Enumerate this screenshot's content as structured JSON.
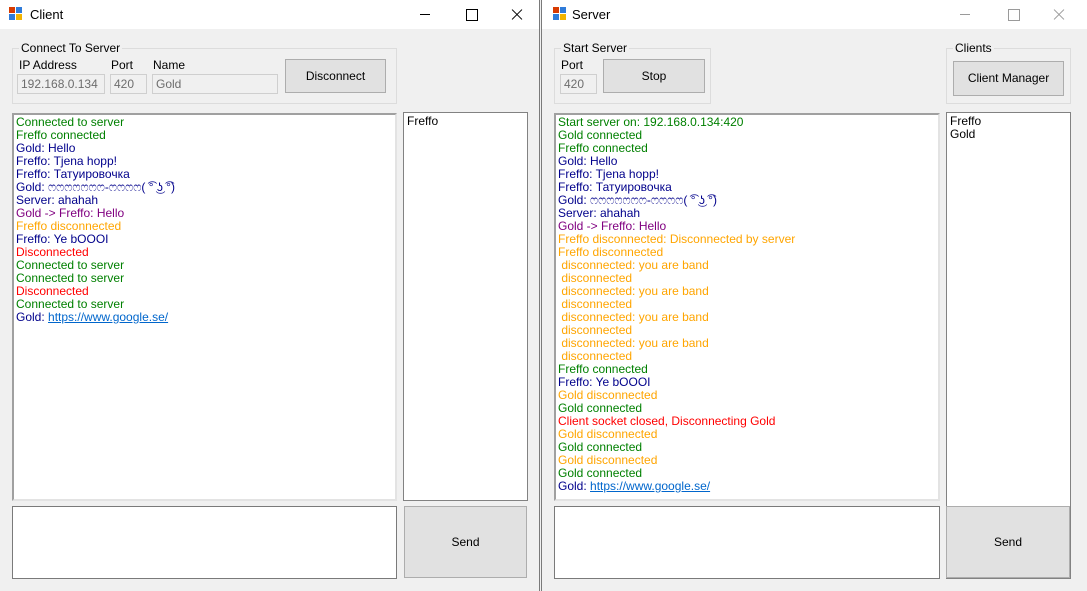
{
  "colors": {
    "green": "#008000",
    "blue": "#00008b",
    "purple": "#800080",
    "orange": "#ffa500",
    "red": "#ff0000",
    "default": "#000000"
  },
  "client": {
    "title": "Client",
    "group_label": "Connect To Server",
    "ip_label": "IP Address",
    "ip_value": "192.168.0.134",
    "port_label": "Port",
    "port_value": "420",
    "name_label": "Name",
    "name_value": "Gold",
    "disconnect_label": "Disconnect",
    "send_label": "Send",
    "users": [
      "Freffo"
    ],
    "messages": [
      {
        "text": "Connected to server",
        "color": "green"
      },
      {
        "text": "Freffo connected",
        "color": "green"
      },
      {
        "text": "Gold: Hello",
        "color": "blue"
      },
      {
        "text": "Freffo: Tjena hopp!",
        "color": "blue"
      },
      {
        "text": "Freffo: Татуировочка",
        "color": "blue"
      },
      {
        "text": "Gold: ෆෆෆෆෆෆෆ-ෆෆෆෆ( ͡° ͜ʖ ͡°)",
        "color": "blue"
      },
      {
        "text": "Server: ahahah",
        "color": "blue"
      },
      {
        "text": "Gold -> Freffo: Hello",
        "color": "purple"
      },
      {
        "text": "Freffo disconnected",
        "color": "orange"
      },
      {
        "text": "Freffo: Ye bOOOI",
        "color": "blue"
      },
      {
        "text": "Disconnected",
        "color": "red"
      },
      {
        "text": "Connected to server",
        "color": "green"
      },
      {
        "text": "Connected to server",
        "color": "green"
      },
      {
        "text": "Disconnected",
        "color": "red"
      },
      {
        "text": "Connected to server",
        "color": "green"
      },
      {
        "text": "Gold: ",
        "link": "https://www.google.se/",
        "color": "blue"
      }
    ]
  },
  "server": {
    "title": "Server",
    "group_label": "Start Server",
    "port_label": "Port",
    "port_value": "420",
    "stop_label": "Stop",
    "clients_group_label": "Clients",
    "client_manager_label": "Client Manager",
    "send_label": "Send",
    "clients": [
      "Freffo",
      "Gold"
    ],
    "messages": [
      {
        "text": "Start server on: 192.168.0.134:420",
        "color": "green"
      },
      {
        "text": "Gold connected",
        "color": "green"
      },
      {
        "text": "Freffo connected",
        "color": "green"
      },
      {
        "text": "Gold: Hello",
        "color": "blue"
      },
      {
        "text": "Freffo: Tjena hopp!",
        "color": "blue"
      },
      {
        "text": "Freffo: Татуировочка",
        "color": "blue"
      },
      {
        "text": "Gold: ෆෆෆෆෆෆෆ-ෆෆෆෆ( ͡° ͜ʖ ͡°)",
        "color": "blue"
      },
      {
        "text": "Server: ahahah",
        "color": "blue"
      },
      {
        "text": "Gold -> Freffo: Hello",
        "color": "purple"
      },
      {
        "text": "Freffo disconnected: Disconnected by server",
        "color": "orange"
      },
      {
        "text": "Freffo disconnected",
        "color": "orange"
      },
      {
        "text": " disconnected: you are band",
        "color": "orange"
      },
      {
        "text": " disconnected",
        "color": "orange"
      },
      {
        "text": " disconnected: you are band",
        "color": "orange"
      },
      {
        "text": " disconnected",
        "color": "orange"
      },
      {
        "text": " disconnected: you are band",
        "color": "orange"
      },
      {
        "text": " disconnected",
        "color": "orange"
      },
      {
        "text": " disconnected: you are band",
        "color": "orange"
      },
      {
        "text": " disconnected",
        "color": "orange"
      },
      {
        "text": "Freffo connected",
        "color": "green"
      },
      {
        "text": "Freffo: Ye bOOOI",
        "color": "blue"
      },
      {
        "text": "Gold disconnected",
        "color": "orange"
      },
      {
        "text": "Gold connected",
        "color": "green"
      },
      {
        "text": "Client socket closed, Disconnecting Gold",
        "color": "red"
      },
      {
        "text": "Gold disconnected",
        "color": "orange"
      },
      {
        "text": "Gold connected",
        "color": "green"
      },
      {
        "text": "Gold disconnected",
        "color": "orange"
      },
      {
        "text": "Gold connected",
        "color": "green"
      },
      {
        "text": "Gold: ",
        "link": "https://www.google.se/",
        "color": "blue"
      }
    ]
  }
}
